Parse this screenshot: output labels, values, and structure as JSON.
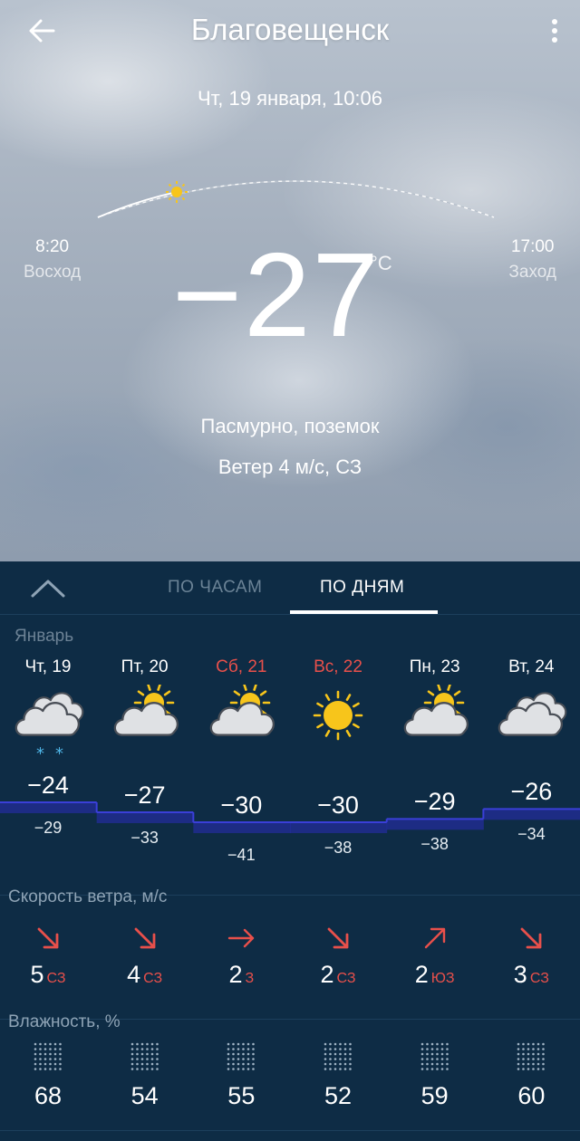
{
  "header": {
    "back_icon": "arrow-left-icon",
    "city": "Благовещенск",
    "menu_icon": "more-vertical-icon"
  },
  "current": {
    "datetime": "Чт, 19 января, 10:06",
    "sunrise_time": "8:20",
    "sunrise_label": "Восход",
    "sunset_time": "17:00",
    "sunset_label": "Заход",
    "temperature": "−27",
    "unit": "°C",
    "condition": "Пасмурно, поземок",
    "wind": "Ветер 4 м/с, СЗ"
  },
  "tabs": {
    "collapse_icon": "chevron-up-icon",
    "hourly": "ПО ЧАСАМ",
    "daily": "ПО ДНЯМ",
    "active": "daily"
  },
  "month": "Январь",
  "days": [
    {
      "label": "Чт, 19",
      "weekend": false,
      "icon": "cloud-snow-icon",
      "max": "−24",
      "min": "−29"
    },
    {
      "label": "Пт, 20",
      "weekend": false,
      "icon": "cloud-sun-icon",
      "max": "−27",
      "min": "−33"
    },
    {
      "label": "Сб, 21",
      "weekend": true,
      "icon": "cloud-sun-icon",
      "max": "−30",
      "min": "−41"
    },
    {
      "label": "Вс, 22",
      "weekend": true,
      "icon": "sun-icon",
      "max": "−30",
      "min": "−38"
    },
    {
      "label": "Пн, 23",
      "weekend": false,
      "icon": "cloud-sun-icon",
      "max": "−29",
      "min": "−38"
    },
    {
      "label": "Вт, 24",
      "weekend": false,
      "icon": "cloud-icon",
      "max": "−26",
      "min": "−34"
    }
  ],
  "wind_section": {
    "title": "Скорость ветра, м/с",
    "items": [
      {
        "speed": "5",
        "dir": "СЗ",
        "arrow_icon": "arrow-down-right-icon"
      },
      {
        "speed": "4",
        "dir": "СЗ",
        "arrow_icon": "arrow-down-right-icon"
      },
      {
        "speed": "2",
        "dir": "З",
        "arrow_icon": "arrow-right-icon"
      },
      {
        "speed": "2",
        "dir": "СЗ",
        "arrow_icon": "arrow-down-right-icon"
      },
      {
        "speed": "2",
        "dir": "ЮЗ",
        "arrow_icon": "arrow-up-right-icon"
      },
      {
        "speed": "3",
        "dir": "СЗ",
        "arrow_icon": "arrow-down-right-icon"
      }
    ]
  },
  "humidity_section": {
    "title": "Влажность, %",
    "values": [
      "68",
      "54",
      "55",
      "52",
      "59",
      "60"
    ]
  },
  "colors": {
    "panel_bg": "#0e2c45",
    "weekend_red": "#e8504b",
    "temp_band": "#2a2eb8",
    "sun_yellow": "#f7c51b"
  }
}
